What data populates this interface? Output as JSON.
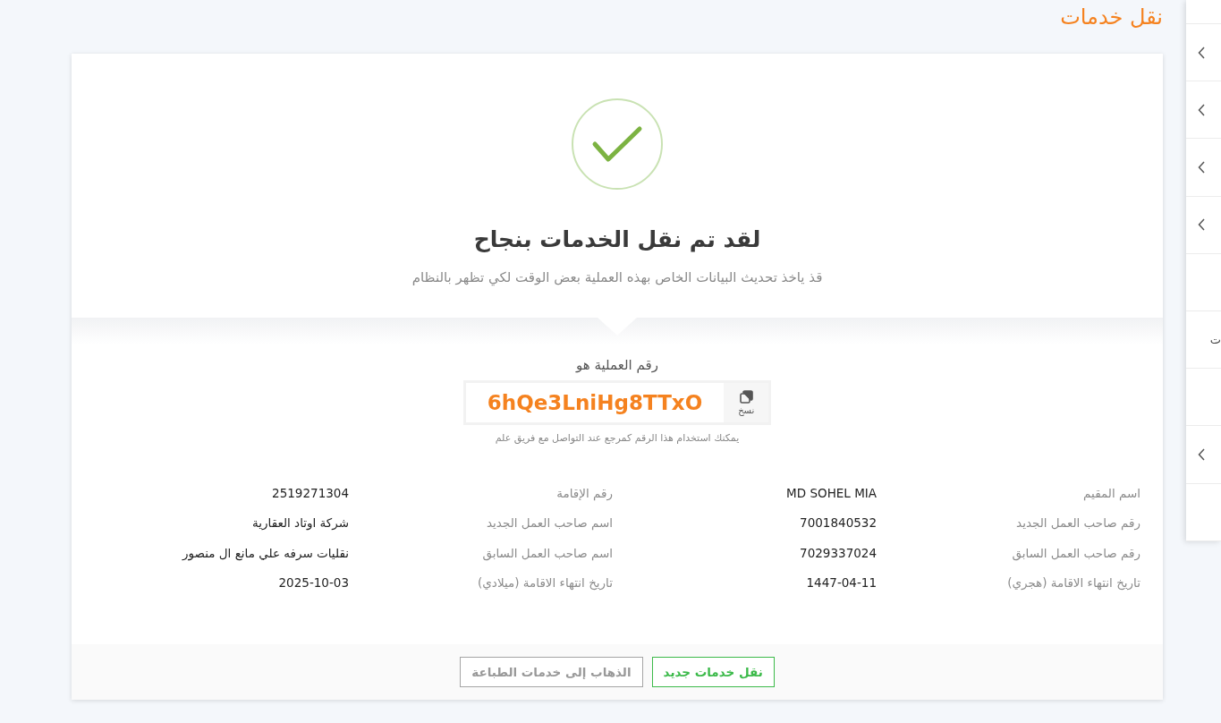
{
  "page_title": "نقل خدمات",
  "success": {
    "title": "لقد تم نقل الخدمات بنجاح",
    "message": "قذ ياخذ تحديث البيانات الخاص بهذه العملية بعض الوقت لكي تظهر بالنظام"
  },
  "reference": {
    "label": "رقم العملية هو",
    "code": "6hQe3LniHg8TTxO",
    "copy_label": "نسخ",
    "hint": "يمكنك استخدام هذا الرقم كمرجع عند التواصل مع فريق علم"
  },
  "details": [
    {
      "label": "اسم المقيم",
      "value": "MD SOHEL MIA"
    },
    {
      "label": "رقم الإقامة",
      "value": "2519271304"
    },
    {
      "label": "رقم صاحب العمل الجديد",
      "value": "7001840532"
    },
    {
      "label": "اسم صاحب العمل الجديد",
      "value": "شركة اوتاد العقارية"
    },
    {
      "label": "رقم صاحب العمل السابق",
      "value": "7029337024"
    },
    {
      "label": "اسم صاحب العمل السابق",
      "value": "نقليات سرفه علي مانع ال منصور"
    },
    {
      "label": "تاريخ انتهاء الاقامة (هجري)",
      "value": "1447-04-11"
    },
    {
      "label": "تاريخ انتهاء الاقامة (ميلادي)",
      "value": "2025-10-03"
    }
  ],
  "actions": [
    {
      "label": "نقل خدمات جديد",
      "kind": "primary"
    },
    {
      "label": "الذهاب إلى خدمات الطباعة",
      "kind": "secondary"
    }
  ],
  "side_menu": {
    "items": [
      {
        "expandable": false
      },
      {
        "expandable": true
      },
      {
        "expandable": true
      },
      {
        "expandable": true
      },
      {
        "expandable": true
      },
      {
        "expandable": false
      },
      {
        "expandable": false,
        "label": "ت"
      },
      {
        "expandable": false
      },
      {
        "expandable": true
      },
      {
        "expandable": false
      }
    ]
  }
}
